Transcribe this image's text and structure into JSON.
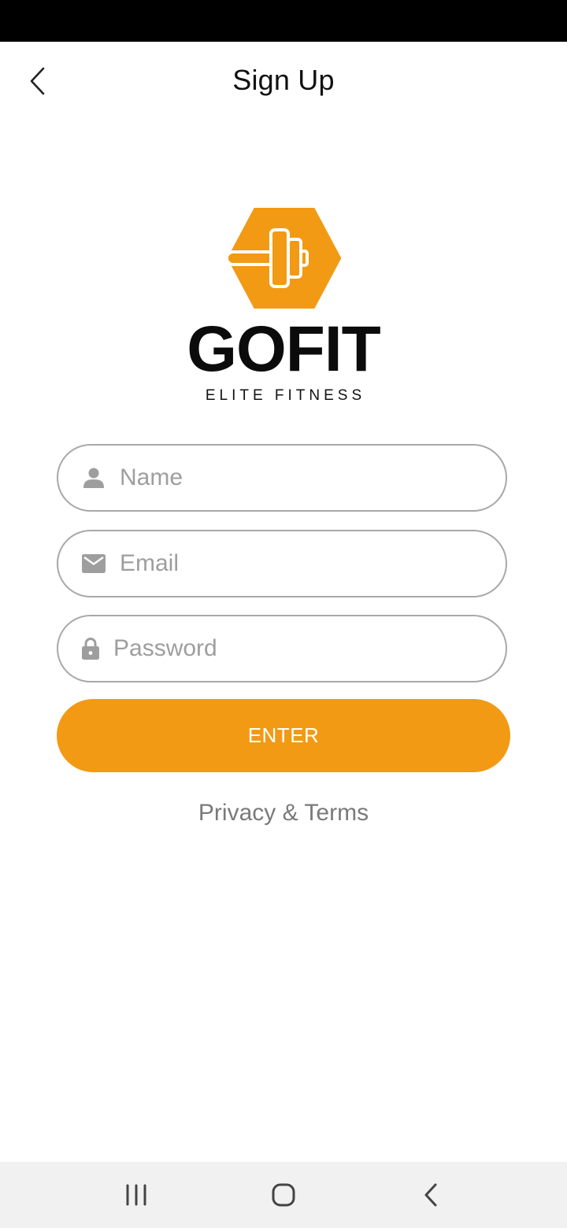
{
  "header": {
    "title": "Sign Up",
    "back_icon": "chevron-left-icon"
  },
  "brand": {
    "logo_icon": "dumbbell-hexagon-icon",
    "name": "GOFIT",
    "tagline": "ELITE FITNESS",
    "accent_color": "#f29a14"
  },
  "form": {
    "name_field": {
      "placeholder": "Name",
      "value": "",
      "icon": "person-icon"
    },
    "email_field": {
      "placeholder": "Email",
      "value": "",
      "icon": "mail-icon"
    },
    "password_field": {
      "placeholder": "Password",
      "value": "",
      "icon": "lock-icon"
    },
    "submit_label": "ENTER"
  },
  "links": {
    "privacy_terms": "Privacy & Terms"
  },
  "nav_bar": {
    "recents_icon": "recents-icon",
    "home_icon": "home-icon",
    "back_icon": "back-icon"
  }
}
